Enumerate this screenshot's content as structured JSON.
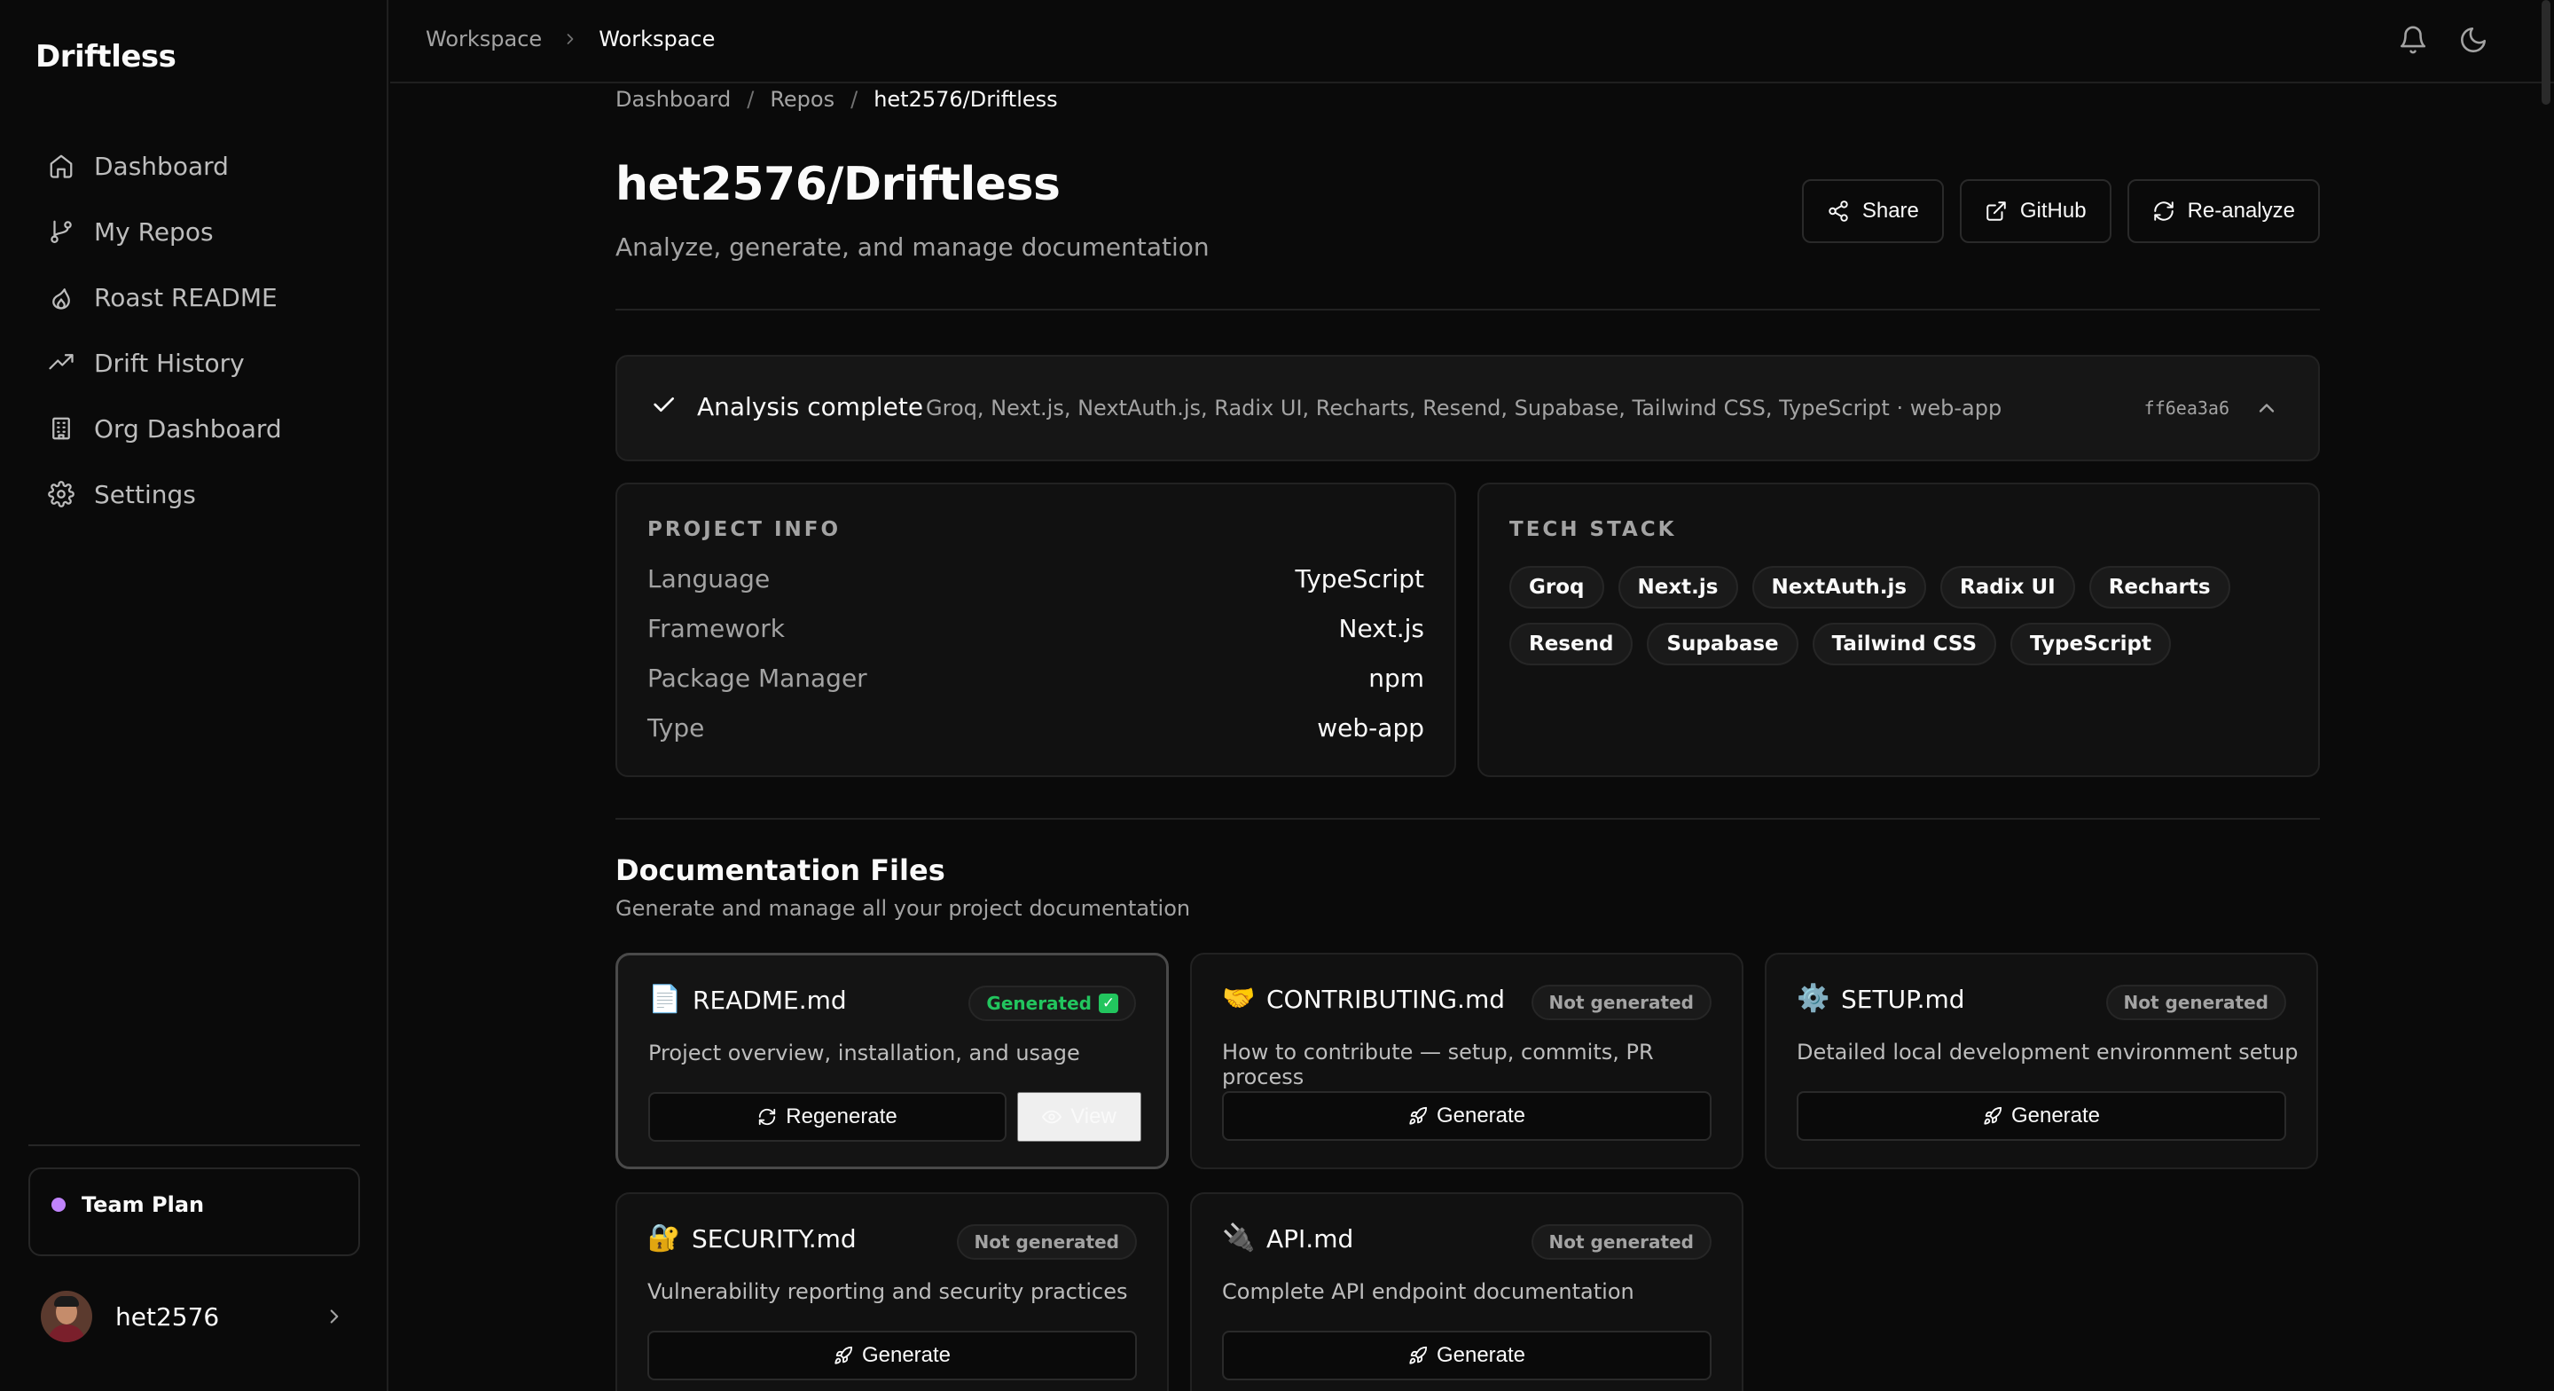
{
  "app": {
    "brand": "Driftless"
  },
  "sidebar": {
    "items": [
      {
        "label": "Dashboard",
        "icon": "home-icon"
      },
      {
        "label": "My Repos",
        "icon": "git-branch-icon"
      },
      {
        "label": "Roast README",
        "icon": "flame-icon"
      },
      {
        "label": "Drift History",
        "icon": "trending-up-icon"
      },
      {
        "label": "Org Dashboard",
        "icon": "building-icon"
      },
      {
        "label": "Settings",
        "icon": "gear-icon"
      }
    ],
    "plan": "Team Plan",
    "plan_color": "#c084fc",
    "user": "het2576"
  },
  "topbar": {
    "crumb_parent": "Workspace",
    "crumb_current": "Workspace"
  },
  "page": {
    "breadcrumb": [
      "Dashboard",
      "Repos",
      "het2576/Driftless"
    ],
    "title": "het2576/Driftless",
    "subtitle": "Analyze, generate, and manage documentation",
    "actions": {
      "share": "Share",
      "github": "GitHub",
      "reanalyze": "Re-analyze"
    }
  },
  "analysis": {
    "title": "Analysis complete",
    "stack": "Groq, Next.js, NextAuth.js, Radix UI, Recharts, Resend, Supabase, Tailwind CSS, TypeScript · web-app",
    "hash": "ff6ea3a6"
  },
  "project_info": {
    "label": "PROJECT INFO",
    "rows": [
      {
        "key": "Language",
        "value": "TypeScript"
      },
      {
        "key": "Framework",
        "value": "Next.js"
      },
      {
        "key": "Package Manager",
        "value": "npm"
      },
      {
        "key": "Type",
        "value": "web-app"
      }
    ]
  },
  "tech_stack": {
    "label": "TECH STACK",
    "tags": [
      "Groq",
      "Next.js",
      "NextAuth.js",
      "Radix UI",
      "Recharts",
      "Resend",
      "Supabase",
      "Tailwind CSS",
      "TypeScript"
    ]
  },
  "docs": {
    "title": "Documentation Files",
    "subtitle": "Generate and manage all your project documentation",
    "files": [
      {
        "name": "README.md",
        "icon": "📄",
        "status": "Generated",
        "desc": "Project overview, installation, and usage",
        "regenerate": "Regenerate",
        "view": "View"
      },
      {
        "name": "CONTRIBUTING.md",
        "icon": "🤝",
        "status": "Not generated",
        "desc": "How to contribute — setup, commits, PR process",
        "action": "Generate"
      },
      {
        "name": "SETUP.md",
        "icon": "⚙️",
        "status": "Not generated",
        "desc": "Detailed local development environment setup",
        "action": "Generate"
      },
      {
        "name": "SECURITY.md",
        "icon": "🔐",
        "status": "Not generated",
        "desc": "Vulnerability reporting and security practices",
        "action": "Generate"
      },
      {
        "name": "API.md",
        "icon": "🔌",
        "status": "Not generated",
        "desc": "Complete API endpoint documentation",
        "action": "Generate"
      }
    ]
  }
}
